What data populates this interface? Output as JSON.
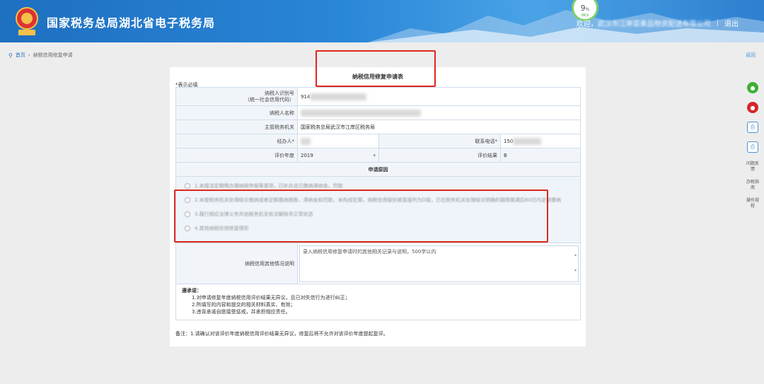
{
  "header": {
    "title": "国家税务总局湖北省电子税务局",
    "welcome": "欢迎，",
    "company": "武汉市江岸菜果品物资配送有限公司",
    "logout": "退出",
    "gauge_value": "9",
    "gauge_unit": "%",
    "gauge_sub": "0K/s"
  },
  "breadcrumb": {
    "home": "首页",
    "current": "纳税信用修复申请"
  },
  "back_link": "返回",
  "side_panel": {
    "items": [
      {
        "icon": "wechat-icon",
        "label": ""
      },
      {
        "icon": "weibo-icon",
        "label": ""
      },
      {
        "icon": "printer-icon",
        "label": ""
      },
      {
        "icon": "printer-icon",
        "label": ""
      }
    ],
    "links": [
      "问题反馈",
      "办税指南",
      "操作规程"
    ]
  },
  "form": {
    "title": "纳税信用修复申请表",
    "required_note": "*表示必填",
    "taxpayer_id_label": "纳税人识别号",
    "taxpayer_id_sub": "（统一社会信用代码）",
    "taxpayer_id_value": "914",
    "taxpayer_name_label": "纳税人名称",
    "tax_authority_label": "主管税务机关",
    "tax_authority_value": "国家税务总局武汉市江岸区税务局",
    "agent_label": "经办人*",
    "phone_label": "联系电话*",
    "phone_value": "150",
    "year_label": "评价年度",
    "year_value": "2019",
    "result_label": "评价结果",
    "result_value": "B",
    "reason_section": "申请原因",
    "reasons": [
      "1.未按法定期限办理纳税申报等事项，已补办且已缴纳滞纳金、罚款",
      "2.未按税务机关处理结论缴纳或者足额缴纳税款、滞纳金和罚款，未构成犯罪，纳税信用级别被直接判为D级，已在税务机关处理结论明确的期限期满后60日内足额缴纳",
      "3.履行相应法律义务并由税务机关依法解除非正常状态",
      "4.其他纳税信用修复情形"
    ],
    "remark_label": "纳税信用其他情况说明",
    "remark_placeholder": "录入纳税信用修复申请时的其他相关记录与说明，500字以内"
  },
  "promise": {
    "head": "遵承诺：",
    "items": [
      "1.对申请修复年度纳税信用评价结果无异议，且已对失信行为进行纠正；",
      "2.所填写的内容和提交的相关材料真实、有效；",
      "3.违背承诺自愿接受惩戒，并承担相应责任。"
    ]
  },
  "note": "备注：1.请确认对该评价年度纳税信用评价结果无异议，修复后将不允许对该评价年度提起复评。",
  "colors": {
    "header_blue": "#2a86d8",
    "highlight_red": "#e0261d",
    "label_bg": "#f1f5fa"
  }
}
